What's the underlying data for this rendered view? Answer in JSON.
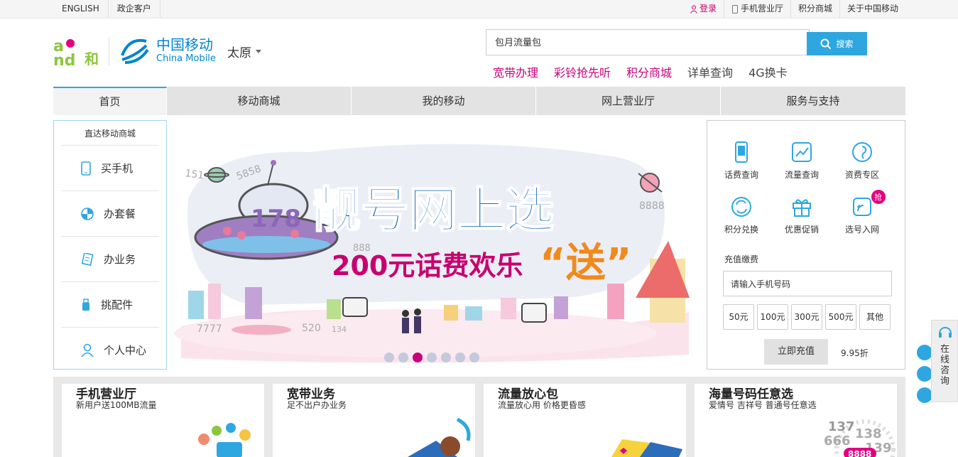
{
  "topbar": {
    "left": [
      "ENGLISH",
      "政企客户"
    ],
    "login": "登录",
    "right": [
      "手机营业厅",
      "积分商城",
      "关于中国移动"
    ]
  },
  "header": {
    "brand_cn": "中国移动",
    "brand_en": "China Mobile",
    "city": "太原",
    "search_value": "包月流量包",
    "search_button": "搜索",
    "hot_links": [
      "宽带办理",
      "彩铃抢先听",
      "积分商城",
      "详单查询",
      "4G换卡"
    ]
  },
  "nav": [
    "首页",
    "移动商城",
    "我的移动",
    "网上营业厅",
    "服务与支持"
  ],
  "shop": {
    "title": "直达移动商城",
    "items": [
      "买手机",
      "办套餐",
      "办业务",
      "挑配件",
      "个人中心"
    ]
  },
  "banner": {
    "headline": "靓号网上选",
    "subline_a": "200元话费欢乐",
    "subline_b": "“送”",
    "ufo_number": "178",
    "numbers": [
      "151",
      "5858",
      "8888",
      "7777",
      "520",
      "134",
      "888"
    ],
    "active_slide": 3,
    "slide_count": 7
  },
  "services": {
    "grid": [
      "话费查询",
      "流量查询",
      "资费专区",
      "积分兑换",
      "优惠促销",
      "选号入网"
    ],
    "badge": "抢",
    "recharge_label": "充值缴费",
    "phone_placeholder": "请输入手机号码",
    "amounts": [
      "50元",
      "100元",
      "300元",
      "500元",
      "其他"
    ],
    "pay_button": "立即充值",
    "discount": "9.95折"
  },
  "promos": [
    {
      "title": "手机营业厅",
      "sub": "新用户送100MB流量"
    },
    {
      "title": "宽带业务",
      "sub": "足不出户办业务"
    },
    {
      "title": "流量放心包",
      "sub": "流量放心用 价格更昏感"
    },
    {
      "title": "海量号码任意选",
      "sub": "爱情号 吉祥号 普通号任意选"
    }
  ],
  "promo_numbers": [
    "137",
    "138",
    "666",
    "139",
    "8888"
  ],
  "consult": "在线咨询",
  "colors": {
    "accent": "#2ea7e0",
    "brand_pink": "#c7007d",
    "cm_blue": "#0085d0"
  }
}
